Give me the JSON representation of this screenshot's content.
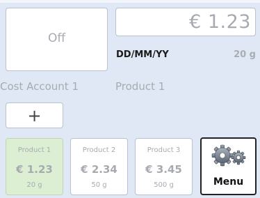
{
  "controls": {
    "off_label": "Off",
    "add_label": "+"
  },
  "display": {
    "price": "€ 1.23",
    "date": "DD/MM/YY",
    "weight": "20 g"
  },
  "labels": {
    "cost_account": "Cost Account 1",
    "product": "Product 1"
  },
  "products": [
    {
      "name": "Product 1",
      "price": "€ 1.23",
      "weight": "20 g",
      "selected": true
    },
    {
      "name": "Product 2",
      "price": "€ 2.34",
      "weight": "50 g",
      "selected": false
    },
    {
      "name": "Product 3",
      "price": "€ 3.45",
      "weight": "500 g",
      "selected": false
    }
  ],
  "menu": {
    "label": "Menu",
    "icon": "gears-icon"
  },
  "colors": {
    "background": "#dfe8f4",
    "selected_tile": "#dcefd3",
    "muted_text": "#a7abb1",
    "border": "#b7c3d1"
  }
}
